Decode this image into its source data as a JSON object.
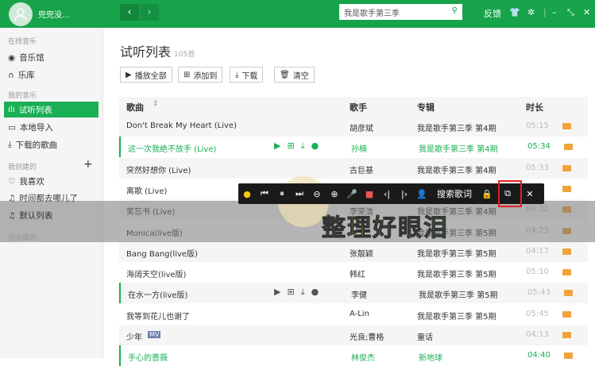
{
  "header": {
    "username": "兜兜没...",
    "search_placeholder": "我是歌手第三季",
    "feedback": "反馈"
  },
  "sidebar": {
    "online_heading": "在线音乐",
    "music_hall": "音乐馆",
    "library": "乐库",
    "my_music_heading": "我的音乐",
    "trial_list": "试听列表",
    "local_import": "本地导入",
    "downloaded": "下载的歌曲",
    "created_heading": "我创建的",
    "favorites": "我喜欢",
    "playlist1": "时间都去哪儿了",
    "default_list": "默认列表",
    "collected_heading": "我收藏的"
  },
  "main": {
    "title": "试听列表",
    "count": "105首",
    "buttons": {
      "play_all": "播放全部",
      "add_to": "添加到",
      "download": "下载",
      "clear": "清空"
    },
    "columns": {
      "song": "歌曲",
      "singer": "歌手",
      "album": "专辑",
      "duration": "时长"
    },
    "rows": [
      {
        "song": "Don't Break My Heart (Live)",
        "singer": "胡彦斌",
        "album": "我是歌手第三季 第4期",
        "dur": "05:15"
      },
      {
        "song": "这一次我绝不放手 (Live)",
        "singer": "孙楠",
        "album": "我是歌手第三季 第4期",
        "dur": "05:34"
      },
      {
        "song": "突然好想你 (Live)",
        "singer": "古巨基",
        "album": "我是歌手第三季 第4期",
        "dur": "05:33"
      },
      {
        "song": "离歌 (Live)",
        "singer": "",
        "album": "",
        "dur": ""
      },
      {
        "song": "笑忘书 (Live)",
        "singer": "李荣浩",
        "album": "我是歌手第三季 第4期",
        "dur": "04:32"
      },
      {
        "song": "Monica(live版)",
        "singer": "",
        "album": "我是歌手第三季 第5期",
        "dur": "04:23"
      },
      {
        "song": "Bang Bang(live版)",
        "singer": "张靓颖",
        "album": "我是歌手第三季 第5期",
        "dur": "04:17"
      },
      {
        "song": "海阔天空(live版)",
        "singer": "韩红",
        "album": "我是歌手第三季 第5期",
        "dur": "05:10"
      },
      {
        "song": "在水一方(live版)",
        "singer": "李健",
        "album": "我是歌手第三季 第5期",
        "dur": "05:43"
      },
      {
        "song": "我等到花儿也谢了",
        "singer": "A-Lin",
        "album": "我是歌手第三季 第5期",
        "dur": "05:45"
      },
      {
        "song": "少年",
        "singer": "光良;曹格",
        "album": "童话",
        "dur": "04:13",
        "badge": "MV"
      },
      {
        "song": "手心的蔷薇",
        "singer": "林俊杰",
        "album": "新地球",
        "dur": "04:40"
      }
    ]
  },
  "lyrics": {
    "search_lyrics": "搜索歌词",
    "line_a": "整理",
    "line_b": "好眼泪"
  },
  "colors": {
    "brand": "#17a34a",
    "quality": "#f0a33b"
  }
}
